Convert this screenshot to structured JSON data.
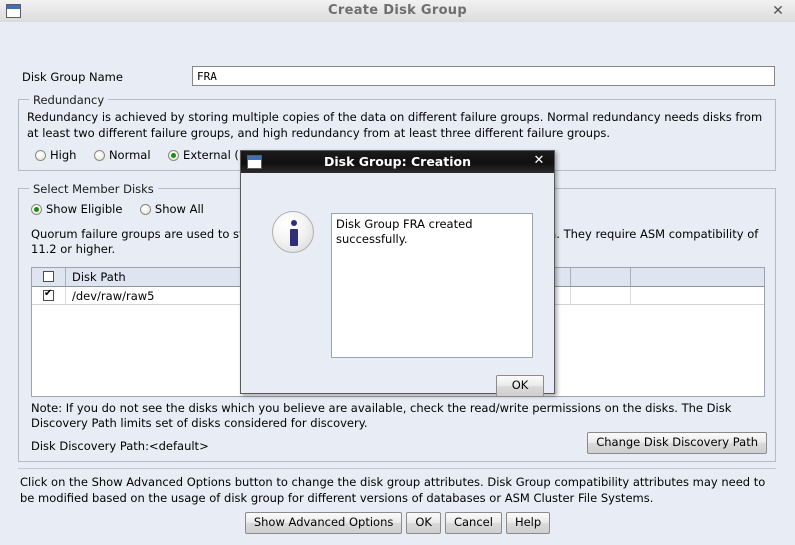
{
  "window": {
    "title": "Create Disk Group",
    "icon": "window-icon",
    "close_label": "✕"
  },
  "form": {
    "disk_group_name_label": "Disk Group Name",
    "disk_group_name_value": "FRA"
  },
  "redundancy": {
    "legend": "Redundancy",
    "description": "Redundancy is achieved by storing multiple copies of the data on different failure groups. Normal redundancy needs disks from at least two different failure groups, and high redundancy from at least three different failure groups.",
    "options": [
      {
        "label": "High",
        "selected": false
      },
      {
        "label": "Normal",
        "selected": false
      },
      {
        "label": "External (None)",
        "selected": true
      }
    ]
  },
  "members": {
    "legend": "Select Member Disks",
    "filter_options": [
      {
        "label": "Show Eligible",
        "selected": true
      },
      {
        "label": "Show All",
        "selected": false
      }
    ],
    "quorum_description": "Quorum failure groups are used to store voting files and they cannot contain any user data. They require ASM compatibility of 11.2 or higher.",
    "table": {
      "columns": [
        "",
        "Disk Path",
        "",
        ""
      ],
      "header_checkbox_checked": false,
      "rows": [
        {
          "checked": true,
          "disk_path": "/dev/raw/raw5",
          "col3": "",
          "col4": ""
        }
      ]
    },
    "note": "Note: If you do not see the disks which you believe are available, check the read/write permissions on the disks. The Disk Discovery Path limits set of disks considered for discovery.",
    "discovery_path_label": "Disk Discovery Path:<default>",
    "change_path_button": "Change Disk Discovery Path"
  },
  "footer": {
    "description": "Click on the Show Advanced Options button to change the disk group attributes. Disk Group compatibility attributes may need to be modified based on the usage of disk group for different versions of databases or ASM Cluster File Systems.",
    "buttons": [
      "Show Advanced Options",
      "OK",
      "Cancel",
      "Help"
    ]
  },
  "modal": {
    "title": "Disk Group: Creation",
    "icon": "window-icon",
    "close_label": "✕",
    "info_icon": "info-icon",
    "message": "Disk Group FRA created successfully.",
    "ok_label": "OK"
  },
  "colors": {
    "window_background": "#e8edf5",
    "modal_titlebar": "#101010",
    "radio_selected": "#1d8a1d",
    "info_blue": "#2e2e7a",
    "desktop": "#c8c8c8"
  }
}
